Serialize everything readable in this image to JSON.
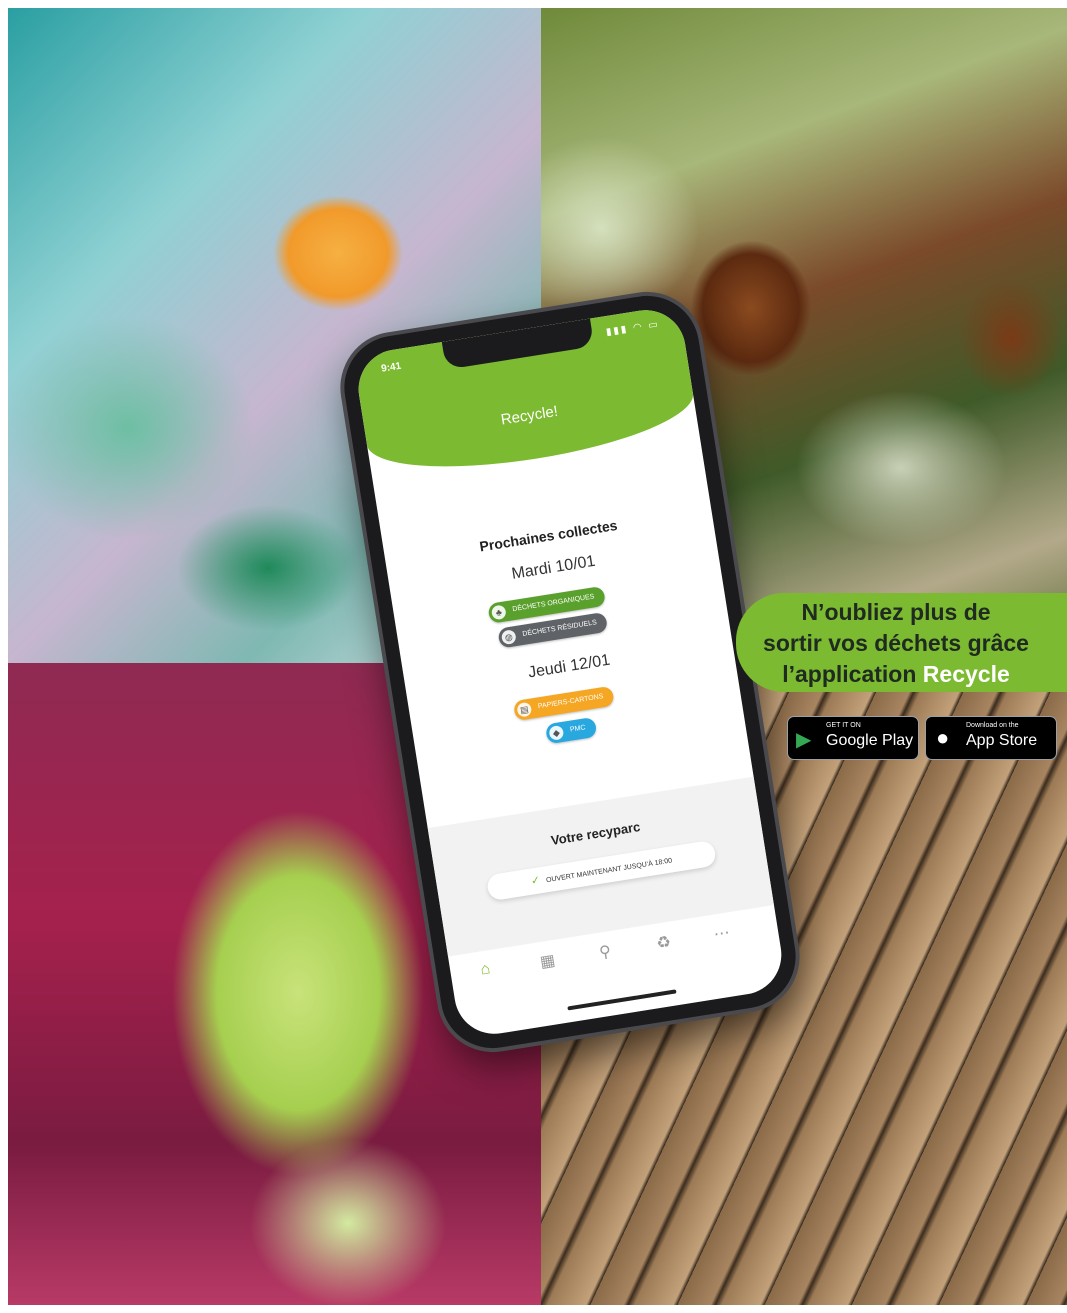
{
  "photos": {
    "top_left": "plastic-packaging-photo",
    "top_right": "organic-waste-photo",
    "bottom_left": "plastic-bottle-photo",
    "bottom_right": "cardboard-photo"
  },
  "phone": {
    "status_time": "9:41",
    "app_title": "Recycle!",
    "collections": {
      "title": "Prochaines collectes",
      "days": [
        {
          "label": "Mardi 10/01",
          "items": [
            {
              "label": "DÉCHETS ORGANIQUES",
              "color": "#5aa02c",
              "icon": "organic-icon"
            },
            {
              "label": "DÉCHETS RÉSIDUELS",
              "color": "#5f6368",
              "icon": "trash-bag-icon"
            }
          ]
        },
        {
          "label": "Jeudi 12/01",
          "items": [
            {
              "label": "PAPIERS-CARTONS",
              "color": "#f5a623",
              "icon": "paper-icon"
            },
            {
              "label": "PMC",
              "color": "#29a8e0",
              "icon": "bottle-icon"
            }
          ]
        }
      ]
    },
    "recyparc": {
      "title": "Votre recyparc",
      "status": "OUVERT MAINTENANT JUSQU'À 18:00"
    },
    "tabs": [
      "home-icon",
      "calendar-icon",
      "map-pin-icon",
      "recycle-icon",
      "more-icon"
    ]
  },
  "promo": {
    "line1": "N’oubliez plus de",
    "line2": "sortir vos déchets grâce",
    "line3_prefix": "l’application ",
    "line3_highlight": "Recycle",
    "bg_color": "#7cba31"
  },
  "stores": {
    "google": {
      "small": "GET IT ON",
      "big": "Google Play"
    },
    "apple": {
      "small": "Download on the",
      "big": "App Store"
    }
  }
}
